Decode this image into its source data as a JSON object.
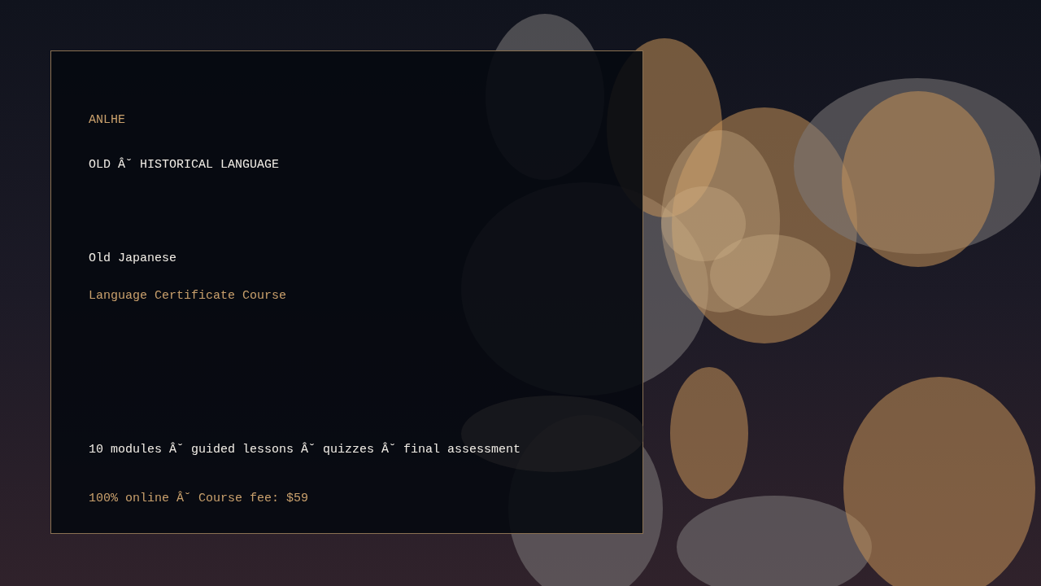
{
  "brand": "ANLHE",
  "category": "OLD Â˘ HISTORICAL LANGUAGE",
  "course": {
    "title": "Old Japanese",
    "subtitle": "Language Certificate Course"
  },
  "details": "10 modules Â˘ guided lessons Â˘ quizzes Â˘ final assessment",
  "pricing": "100% online Â˘ Course fee: $59"
}
